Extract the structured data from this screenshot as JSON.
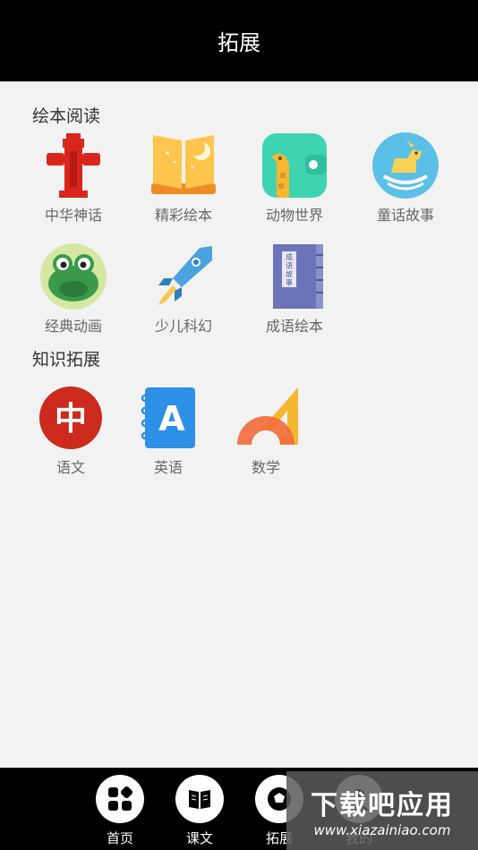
{
  "header": {
    "title": "拓展"
  },
  "sections": {
    "reading": {
      "title": "绘本阅读",
      "items": [
        {
          "label": "中华神话",
          "icon": "hydrant-icon"
        },
        {
          "label": "精彩绘本",
          "icon": "open-book-moon-icon"
        },
        {
          "label": "动物世界",
          "icon": "giraffe-icon"
        },
        {
          "label": "童话故事",
          "icon": "rocking-horse-icon"
        },
        {
          "label": "经典动画",
          "icon": "frog-icon"
        },
        {
          "label": "少儿科幻",
          "icon": "rocket-icon"
        },
        {
          "label": "成语绘本",
          "icon": "idiom-book-icon"
        }
      ],
      "idiom_book_text": "成语故事"
    },
    "knowledge": {
      "title": "知识拓展",
      "items": [
        {
          "label": "语文",
          "icon": "chinese-char-icon",
          "glyph": "中"
        },
        {
          "label": "英语",
          "icon": "english-notebook-icon",
          "glyph": "A"
        },
        {
          "label": "数学",
          "icon": "protractor-ruler-icon"
        }
      ]
    }
  },
  "bottom_nav": {
    "items": [
      {
        "label": "首页",
        "icon": "home-grid-icon"
      },
      {
        "label": "课文",
        "icon": "book-icon"
      },
      {
        "label": "拓展",
        "icon": "soccer-ball-icon"
      },
      {
        "label": "我的",
        "icon": "profile-icon"
      }
    ]
  },
  "watermark": {
    "title": "下载吧应用",
    "url": "www.xiazainiao.com"
  }
}
